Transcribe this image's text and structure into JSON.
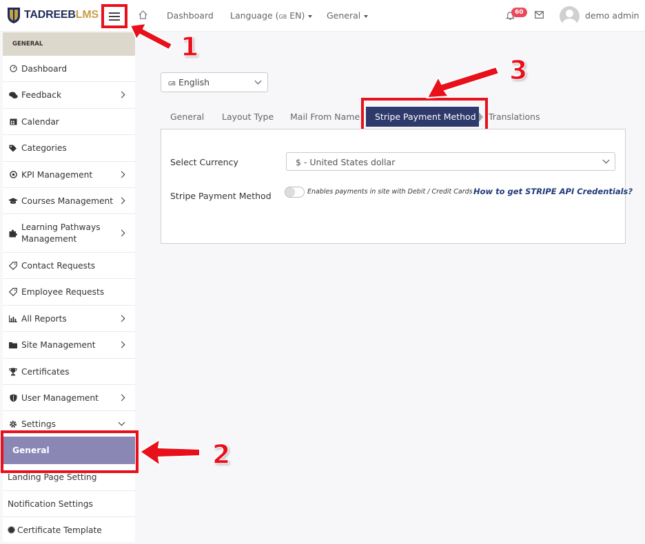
{
  "header": {
    "logo_main": "TADREEB",
    "logo_accent": "LMS",
    "nav": {
      "dashboard": "Dashboard",
      "language_prefix": "Language (",
      "language_flag": "GB",
      "language_suffix": " EN)",
      "general": "General"
    },
    "notification_count": "60",
    "user_name": "demo admin"
  },
  "sidebar": {
    "section_title": "GENERAL",
    "items": [
      {
        "label": "Dashboard",
        "icon": "dashboard-gauge-icon"
      },
      {
        "label": "Feedback",
        "icon": "comments-icon"
      },
      {
        "label": "Calendar",
        "icon": "calendar-icon"
      },
      {
        "label": "Categories",
        "icon": "tags-icon"
      },
      {
        "label": "KPI Management",
        "icon": "target-icon"
      },
      {
        "label": "Courses Management",
        "icon": "graduation-cap-icon"
      },
      {
        "label": "Learning Pathways\nManagement",
        "icon": "puzzle-icon"
      },
      {
        "label": "Contact Requests",
        "icon": "tag-outline-icon"
      },
      {
        "label": "Employee Requests",
        "icon": "tag-outline-icon"
      },
      {
        "label": "All Reports",
        "icon": "bar-chart-icon"
      },
      {
        "label": "Site Management",
        "icon": "folder-icon"
      },
      {
        "label": "Certificates",
        "icon": "trophy-icon"
      },
      {
        "label": "User Management",
        "icon": "shield-icon"
      },
      {
        "label": "Settings",
        "icon": "gear-icon"
      }
    ],
    "submenu": [
      {
        "label": "General"
      },
      {
        "label": "Landing Page Setting"
      },
      {
        "label": "Notification Settings"
      },
      {
        "label": "Certificate Template",
        "icon": "certificate-badge-icon"
      }
    ]
  },
  "main": {
    "language_select": {
      "flag": "GB",
      "value": "English"
    },
    "tabs": [
      {
        "label": "General"
      },
      {
        "label": "Layout Type"
      },
      {
        "label": "Mail From Name"
      },
      {
        "label": "Stripe Payment Method"
      },
      {
        "label": "Translations"
      }
    ],
    "active_tab": "Stripe Payment Method",
    "fields": {
      "currency_label": "Select Currency",
      "currency_value": "$ - United States dollar",
      "stripe_label": "Stripe Payment Method",
      "stripe_enabled": false,
      "stripe_help": "Enables payments in site with Debit / Credit Cards",
      "stripe_link": "How to get STRIPE API Credentials?"
    }
  },
  "callouts": [
    "1",
    "2",
    "3"
  ],
  "colors": {
    "brand_navy": "#1f2b57",
    "brand_gold": "#c5a147",
    "active_tab": "#2d3a6b",
    "active_submenu": "#8b87b5",
    "callout_red": "#e8101a",
    "badge_red": "#e84a5a"
  }
}
